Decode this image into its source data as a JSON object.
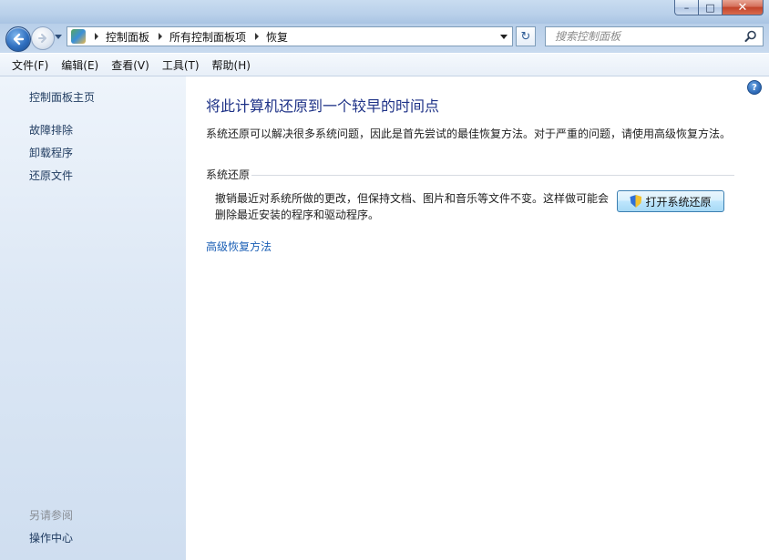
{
  "window": {
    "caption": {
      "minimize": "–",
      "maximize": "□",
      "close": "✕"
    }
  },
  "nav": {
    "breadcrumb": [
      "控制面板",
      "所有控制面板项",
      "恢复"
    ],
    "search_placeholder": "搜索控制面板",
    "refresh_glyph": "↻"
  },
  "menu": [
    "文件(F)",
    "编辑(E)",
    "查看(V)",
    "工具(T)",
    "帮助(H)"
  ],
  "sidebar": {
    "home": "控制面板主页",
    "links": [
      "故障排除",
      "卸载程序",
      "还原文件"
    ],
    "see_also_label": "另请参阅",
    "see_also": [
      "操作中心"
    ]
  },
  "main": {
    "help_glyph": "?",
    "title": "将此计算机还原到一个较早的时间点",
    "intro": "系统还原可以解决很多系统问题，因此是首先尝试的最佳恢复方法。对于严重的问题，请使用高级恢复方法。",
    "group_title": "系统还原",
    "description": "撤销最近对系统所做的更改，但保持文档、图片和音乐等文件不变。这样做可能会删除最近安装的程序和驱动程序。",
    "open_button": "打开系统还原",
    "advanced_link": "高级恢复方法"
  },
  "colors": {
    "title_blue": "#1e3287",
    "link_blue": "#1b5fb5",
    "sidebar_link": "#1e3a5f",
    "muted": "#8a8f96"
  }
}
